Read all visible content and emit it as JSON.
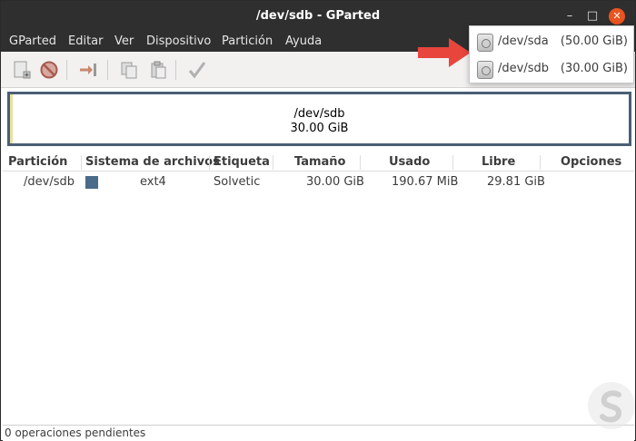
{
  "window": {
    "title": "/dev/sdb - GParted"
  },
  "menu": {
    "items": [
      "GParted",
      "Editar",
      "Ver",
      "Dispositivo",
      "Partición",
      "Ayuda"
    ]
  },
  "toolbar": {
    "icons": [
      "new-partition-icon",
      "delete-icon",
      "resize-move-icon",
      "copy-icon",
      "paste-icon",
      "apply-icon"
    ]
  },
  "disk_graphic": {
    "device": "/dev/sdb",
    "size": "30.00 GiB"
  },
  "table": {
    "columns": [
      "Partición",
      "Sistema de archivos",
      "Etiqueta",
      "Tamaño",
      "Usado",
      "Libre",
      "Opciones"
    ],
    "rows": [
      {
        "partition": "/dev/sdb",
        "filesystem": "ext4",
        "fs_color": "#4b6b8a",
        "label": "Solvetic",
        "size": "30.00 GiB",
        "used": "190.67 MiB",
        "free": "29.81 GiB",
        "flags": ""
      }
    ]
  },
  "device_menu": {
    "items": [
      {
        "device": "/dev/sda",
        "capacity": "(50.00 GiB)"
      },
      {
        "device": "/dev/sdb",
        "capacity": "(30.00 GiB)"
      }
    ]
  },
  "status": {
    "text": "0 operaciones pendientes"
  },
  "colors": {
    "accent": "#e95420",
    "arrow": "#e8453c",
    "partition": "#4b6b8a"
  }
}
